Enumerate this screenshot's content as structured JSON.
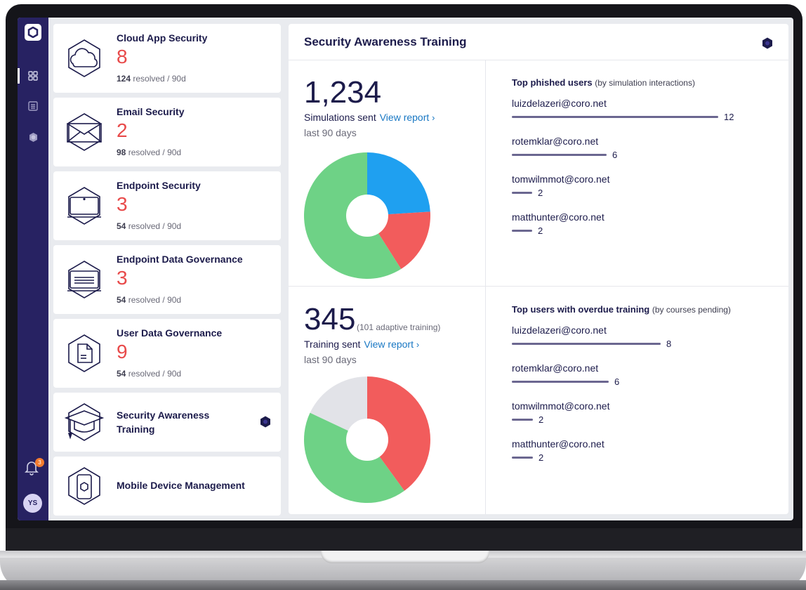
{
  "sidebar": {
    "notifications_count": "3",
    "avatar_initials": "YS"
  },
  "modules": [
    {
      "title": "Cloud App Security",
      "count": "8",
      "resolved": "124",
      "suffix": "resolved / 90d"
    },
    {
      "title": "Email Security",
      "count": "2",
      "resolved": "98",
      "suffix": "resolved / 90d"
    },
    {
      "title": "Endpoint Security",
      "count": "3",
      "resolved": "54",
      "suffix": "resolved / 90d"
    },
    {
      "title": "Endpoint Data Governance",
      "count": "3",
      "resolved": "54",
      "suffix": "resolved / 90d"
    },
    {
      "title": "User Data Governance",
      "count": "9",
      "resolved": "54",
      "suffix": "resolved / 90d"
    },
    {
      "title_line1": "Security Awareness",
      "title_line2": "Training"
    },
    {
      "title": "Mobile Device Management"
    }
  ],
  "panel": {
    "title": "Security Awareness Training",
    "simulations": {
      "number": "1,234",
      "label": "Simulations sent",
      "link": "View report",
      "period": "last 90 days",
      "pie": [
        {
          "value": 24,
          "color": "#1fa0f0"
        },
        {
          "value": 17,
          "color": "#f25c5c"
        },
        {
          "value": 59,
          "color": "#6ed286"
        }
      ]
    },
    "training": {
      "number": "345",
      "adaptive": "(101 adaptive training)",
      "label": "Training sent",
      "link": "View report",
      "period": "last 90 days",
      "pie": [
        {
          "value": 40,
          "color": "#f25c5c"
        },
        {
          "value": 42,
          "color": "#6ed286"
        },
        {
          "value": 18,
          "color": "#e2e3e8"
        }
      ]
    },
    "phished": {
      "title": "Top phished users",
      "qualifier": "(by simulation interactions)",
      "users": [
        {
          "email": "luizdelazeri@coro.net",
          "count": "12",
          "ratio": 1.0
        },
        {
          "email": "rotemklar@coro.net",
          "count": "6",
          "ratio": 0.46
        },
        {
          "email": "tomwilmmot@coro.net",
          "count": "2",
          "ratio": 0.1
        },
        {
          "email": "matthunter@coro.net",
          "count": "2",
          "ratio": 0.1
        }
      ]
    },
    "overdue": {
      "title": "Top users with overdue training",
      "qualifier": "(by courses pending)",
      "users": [
        {
          "email": "luizdelazeri@coro.net",
          "count": "8",
          "ratio": 1.0
        },
        {
          "email": "rotemklar@coro.net",
          "count": "6",
          "ratio": 0.65
        },
        {
          "email": "tomwilmmot@coro.net",
          "count": "2",
          "ratio": 0.14
        },
        {
          "email": "matthunter@coro.net",
          "count": "2",
          "ratio": 0.14
        }
      ]
    }
  }
}
